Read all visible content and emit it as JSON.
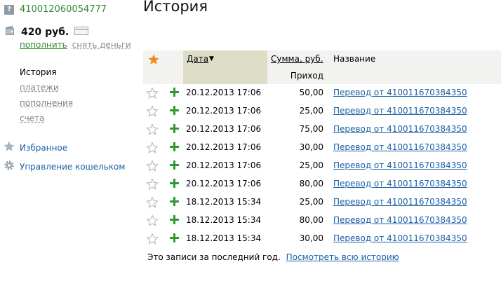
{
  "account": {
    "number": "410012060054777"
  },
  "balance": {
    "amount": "420 руб."
  },
  "actions": {
    "topup": "пополнить",
    "withdraw": "снять деньги"
  },
  "nav": [
    {
      "label": "История"
    },
    {
      "label": "платежи"
    },
    {
      "label": "пополнения"
    },
    {
      "label": "счета"
    }
  ],
  "links": {
    "favorites": "Избранное",
    "wallet_settings": "Управление кошельком"
  },
  "page": {
    "title": "История"
  },
  "table": {
    "headers": {
      "date": "Дата",
      "sum": "Сумма, руб.",
      "income": "Приход",
      "name": "Название"
    },
    "rows": [
      {
        "date": "20.12.2013 17:06",
        "sum": "50,00",
        "name": "Перевод от 410011670384350"
      },
      {
        "date": "20.12.2013 17:06",
        "sum": "25,00",
        "name": "Перевод от 410011670384350"
      },
      {
        "date": "20.12.2013 17:06",
        "sum": "75,00",
        "name": "Перевод от 410011670384350"
      },
      {
        "date": "20.12.2013 17:06",
        "sum": "30,00",
        "name": "Перевод от 410011670384350"
      },
      {
        "date": "20.12.2013 17:06",
        "sum": "25,00",
        "name": "Перевод от 410011670384350"
      },
      {
        "date": "20.12.2013 17:06",
        "sum": "80,00",
        "name": "Перевод от 410011670384350"
      },
      {
        "date": "18.12.2013 15:34",
        "sum": "25,00",
        "name": "Перевод от 410011670384350"
      },
      {
        "date": "18.12.2013 15:34",
        "sum": "80,00",
        "name": "Перевод от 410011670384350"
      },
      {
        "date": "18.12.2013 15:34",
        "sum": "30,00",
        "name": "Перевод от 410011670384350"
      }
    ]
  },
  "footer": {
    "note": "Это записи за последний год.",
    "link": "Посмотреть всю историю"
  },
  "icons": {
    "account": "question-icon",
    "balance": "wallet-icon",
    "card": "card-icon",
    "favorite": "star-icon",
    "settings": "gear-icon",
    "income": "plus-icon",
    "sort": "sort-down-icon"
  },
  "colors": {
    "accent_green": "#2e8a2e",
    "link_blue": "#1a5fa8",
    "star_orange": "#f28a1c",
    "sorted_column": "#ddddc8"
  }
}
